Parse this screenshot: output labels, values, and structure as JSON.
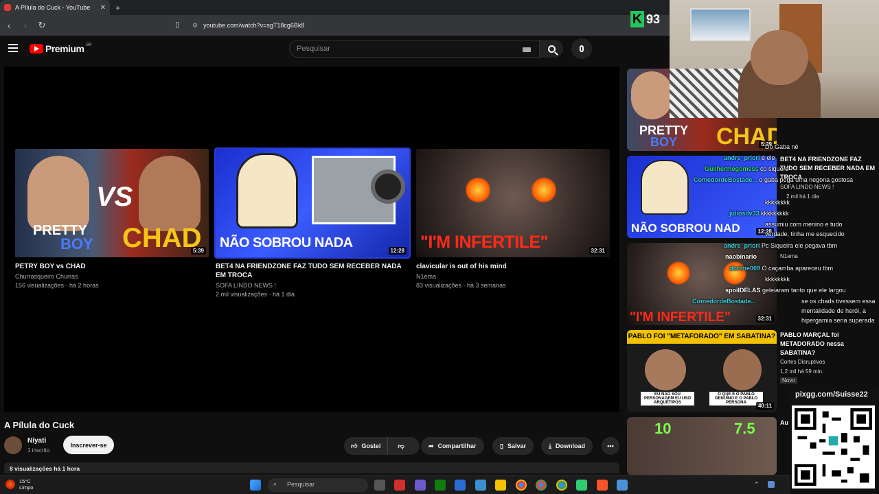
{
  "browser": {
    "tab_title": "A Pílula do Cuck - YouTube",
    "url": "youtube.com/watch?v=sgT18cg6Bk8"
  },
  "youtube": {
    "logo_text": "Premium",
    "logo_region": "BR",
    "search_placeholder": "Pesquisar"
  },
  "endscreen": [
    {
      "title": "PETRY BOY vs CHAD",
      "channel": "Churrasqueiro Churras",
      "meta": "156 visualizações · há 2 horas",
      "duration": "5:39",
      "thumb_text_1": "PRETTY",
      "thumb_text_2": "BOY",
      "thumb_text_3": "CHAD",
      "thumb_text_vs": "VS"
    },
    {
      "title": "BET4 NA FRIENDZONE FAZ TUDO SEM RECEBER NADA EM TROCA",
      "channel": "SOFA LINDO NEWS !",
      "meta": "2 mil visualizações · há 1 dia",
      "duration": "12:28",
      "thumb_text": "NÃO SOBROU NADA"
    },
    {
      "title": "clavicular is out of his mind",
      "channel": "N1ema",
      "meta": "83 visualizações · há 3 semanas",
      "duration": "32:31",
      "thumb_text": "\"I'M INFERTILE\""
    }
  ],
  "video": {
    "title": "A Pílula do Cuck",
    "channel": "Niyati",
    "subscribers": "1 inscrito",
    "subscribe_label": "Inscrever-se",
    "like_label": "Gostei",
    "share_label": "Compartilhar",
    "save_label": "Salvar",
    "download_label": "Download",
    "views": "8 visualizações  há 1 hora"
  },
  "sidebar": [
    {
      "duration": "5:39",
      "thumb_text_1": "PRETTY",
      "thumb_text_2": "BOY",
      "thumb_text_3": "CHAD"
    },
    {
      "duration": "12:28",
      "thumb_text": "NÃO SOBROU NAD"
    },
    {
      "duration": "32:31",
      "thumb_text": "\"I'M INFERTILE\""
    },
    {
      "duration": "40:11",
      "thumb_text": "PABLO FOI \"METAFORADO\" EM SABATINA?",
      "caption_l": "EU NÃO SOU PERSONAGEM EU USO ARQUÉTIPOS",
      "caption_r": "O QUE É O PABLO GENUÍNO E O PABLO PERSONA",
      "title": "PABLO MARÇAL foi METADORADO nessa SABATINA?",
      "channel": "Cortes Disruptivos",
      "meta": "1,2 mil  há 59 min.",
      "badge": "Novo"
    },
    {
      "score_l": "10",
      "score_r": "7.5",
      "title_partial": "Au"
    }
  ],
  "sidebar_text": {
    "t1": "BET4 NA FRIENDZONE FAZ TUDO SEM RECEBER NADA EM TROCA",
    "t1_channel": "SOFA LINDO NEWS !",
    "t1_meta": "2 mil  há 1 dia",
    "t2_channel": "N1ema"
  },
  "chat": [
    {
      "user": "",
      "text": "Do Gaba né"
    },
    {
      "user": "andre_priori",
      "text": "é ele"
    },
    {
      "user": "Guilhermegomess",
      "text": "cp siquers"
    },
    {
      "user": "ComedordeBostade...",
      "text": "o gaba pega uma negona gostosa"
    },
    {
      "user": "",
      "text": "kkkkkkkk"
    },
    {
      "user": "juliosilv33",
      "text": "kkkkkkkkk"
    },
    {
      "user": "",
      "text": "assumiu com menino e tudo verdade, tinha me esquecido"
    },
    {
      "user": "andre_priori",
      "text": "Pc Siqueira ele pegava tbm"
    },
    {
      "user": "naobinario",
      "text": ""
    },
    {
      "user": "dorime009",
      "text": "O caçamba apareceu tbm"
    },
    {
      "user": "",
      "text": "kkkkkkkk"
    },
    {
      "user": "spoilDELAS",
      "text": "geleiaram tanto que ele largou"
    },
    {
      "user": "ComedordeBostade...",
      "text": "se os chads tivessem essa mentalidade de herói, a hipergamia seria superada"
    }
  ],
  "overlay": {
    "k_label": "K",
    "k_count": "93",
    "pix_url": "pixgg.com/Suisse22"
  },
  "taskbar": {
    "temp": "15°C",
    "condition": "Limpo",
    "search": "Pesquisar"
  },
  "colors": {
    "bg": "#0f0f0f",
    "yt_red": "#ff0000",
    "chat_user_cyan": "#3bd1e0",
    "chat_user_green": "#2ee06a",
    "k_green": "#22c55e"
  }
}
